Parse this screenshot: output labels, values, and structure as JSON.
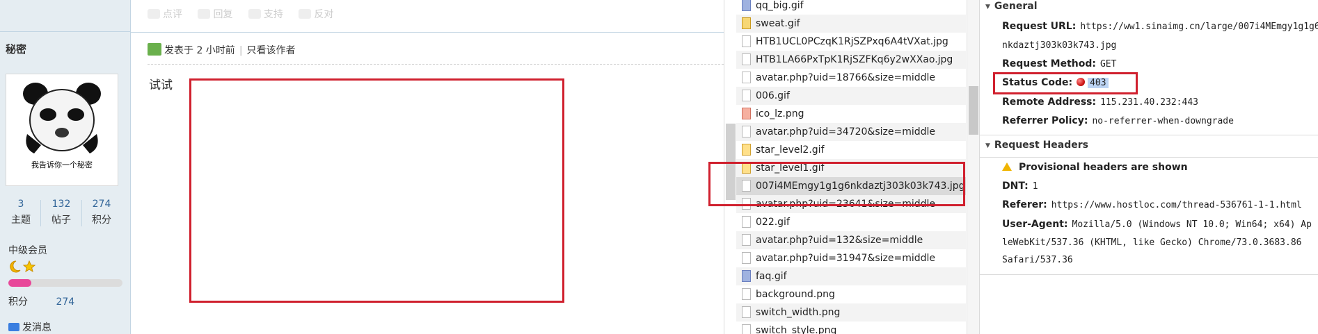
{
  "forum": {
    "username": "秘密",
    "avatar_caption": "我告诉你一个秘密",
    "stats": [
      {
        "value": "3",
        "label": "主题"
      },
      {
        "value": "132",
        "label": "帖子"
      },
      {
        "value": "274",
        "label": "积分"
      }
    ],
    "rank": "中级会员",
    "credit_label": "积分",
    "credit_value": "274",
    "credit_progress": 0.2,
    "send_message": "发消息",
    "actions": [
      "点评",
      "回复",
      "支持",
      "反对"
    ],
    "post_time": "发表于 2 小时前",
    "only_author": "只看该作者",
    "post_text": "试试"
  },
  "network_list": [
    {
      "name": "qq_big.gif",
      "icon": "blue"
    },
    {
      "name": "sweat.gif",
      "icon": "img"
    },
    {
      "name": "HTB1UCL0PCzqK1RjSZPxq6A4tVXat.jpg",
      "icon": "blank"
    },
    {
      "name": "HTB1LA66PxTpK1RjSZFKq6y2wXXao.jpg",
      "icon": "blank"
    },
    {
      "name": "avatar.php?uid=18766&size=middle",
      "icon": "blank"
    },
    {
      "name": "006.gif",
      "icon": "blank"
    },
    {
      "name": "ico_lz.png",
      "icon": "png"
    },
    {
      "name": "avatar.php?uid=34720&size=middle",
      "icon": "blank"
    },
    {
      "name": "star_level2.gif",
      "icon": "gif"
    },
    {
      "name": "star_level1.gif",
      "icon": "gif"
    },
    {
      "name": "007i4MEmgy1g1g6nkdaztj303k03k743.jpg",
      "icon": "blank"
    },
    {
      "name": "avatar.php?uid=23641&size=middle",
      "icon": "blank"
    },
    {
      "name": "022.gif",
      "icon": "blank"
    },
    {
      "name": "avatar.php?uid=132&size=middle",
      "icon": "blank"
    },
    {
      "name": "avatar.php?uid=31947&size=middle",
      "icon": "blank"
    },
    {
      "name": "faq.gif",
      "icon": "blue"
    },
    {
      "name": "background.png",
      "icon": "blank"
    },
    {
      "name": "switch_width.png",
      "icon": "blank"
    },
    {
      "name": "switch_style.png",
      "icon": "blank"
    }
  ],
  "selected_row": 10,
  "details": {
    "general_title": "General",
    "request_url_label": "Request URL:",
    "request_url_line1": "https://ww1.sinaimg.cn/large/007i4MEmgy1g1g6",
    "request_url_line2": "nkdaztj303k03k743.jpg",
    "request_method_label": "Request Method:",
    "request_method": "GET",
    "status_code_label": "Status Code:",
    "status_code": "403",
    "remote_address_label": "Remote Address:",
    "remote_address": "115.231.40.232:443",
    "referrer_policy_label": "Referrer Policy:",
    "referrer_policy": "no-referrer-when-downgrade",
    "request_headers_title": "Request Headers",
    "provisional_warning": "Provisional headers are shown",
    "dnt_label": "DNT:",
    "dnt": "1",
    "referer_label": "Referer:",
    "referer": "https://www.hostloc.com/thread-536761-1-1.html",
    "user_agent_label": "User-Agent:",
    "user_agent_line1": "Mozilla/5.0 (Windows NT 10.0; Win64; x64) Ap",
    "user_agent_line2": "leWebKit/537.36 (KHTML, like Gecko) Chrome/73.0.3683.86",
    "user_agent_line3": "Safari/537.36"
  },
  "colors": {
    "highlight_red": "#d0202e",
    "forum_sidebar": "#e5edf2",
    "link_blue": "#336699",
    "credit_bar": "#e8489a"
  }
}
